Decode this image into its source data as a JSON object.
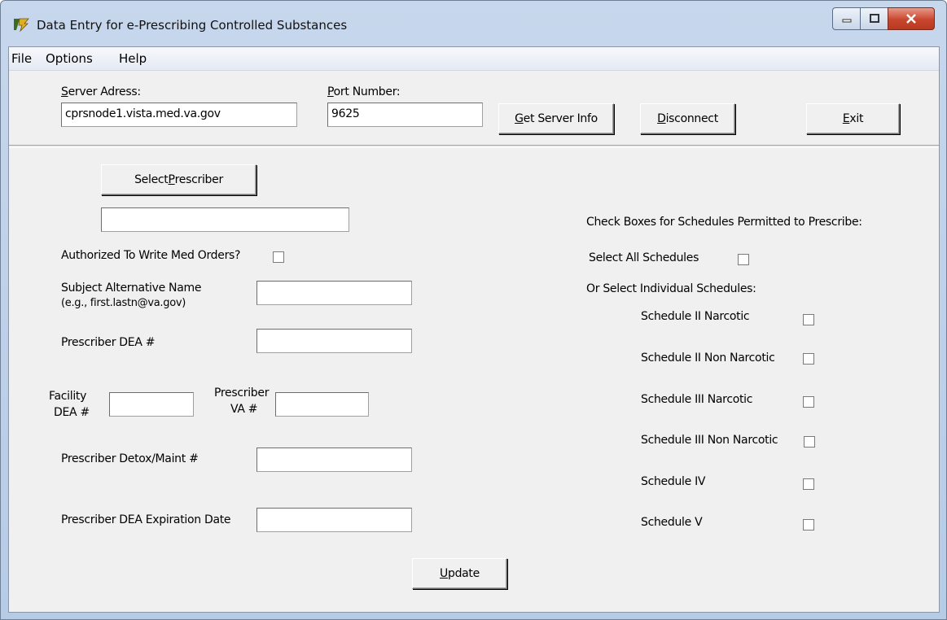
{
  "window": {
    "title": "Data Entry for e-Prescribing Controlled Substances",
    "min_icon": "minimize-icon",
    "max_icon": "maximize-icon",
    "close_icon": "close-icon"
  },
  "menu": {
    "file": "File",
    "options": "Options",
    "help": "Help"
  },
  "server": {
    "address_label_u": "S",
    "address_label_rest": "erver Adress:",
    "address_value": "cprsnode1.vista.med.va.gov",
    "port_label_u": "P",
    "port_label_rest": "ort Number:",
    "port_value": "9625",
    "get_info_u": "G",
    "get_info_rest": "et Server Info",
    "disconnect_u": "D",
    "disconnect_rest": "isconnect",
    "exit_u": "E",
    "exit_rest": "xit"
  },
  "prescriber": {
    "select_pre": "Select ",
    "select_u": "P",
    "select_rest": "rescriber",
    "name_value": "",
    "authorized_label": "Authorized To Write Med Orders?",
    "san_label_1": "Subject Alternative Name",
    "san_label_2": "(e.g., first.lastn@va.gov)",
    "dea_label": "Prescriber DEA #",
    "facility_label_1": "Facility",
    "facility_label_2": "DEA #",
    "va_label_1": "Prescriber",
    "va_label_2": "VA #",
    "detox_label": "Prescriber Detox/Maint #",
    "expiration_label": "Prescriber DEA Expiration Date",
    "update_u": "U",
    "update_rest": "pdate"
  },
  "schedules": {
    "heading": "Check Boxes for Schedules Permitted to Prescribe:",
    "select_all": "Select All Schedules",
    "individual": "Or Select Individual Schedules:",
    "items": [
      "Schedule II Narcotic",
      "Schedule II Non Narcotic",
      "Schedule III Narcotic",
      "Schedule III Non Narcotic",
      "Schedule IV",
      "Schedule V"
    ]
  }
}
